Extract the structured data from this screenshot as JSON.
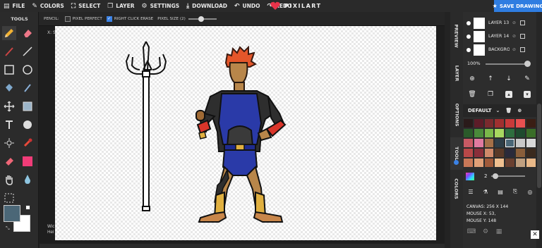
{
  "menu": [
    {
      "label": "FILE",
      "icon": "file-icon"
    },
    {
      "label": "COLORS",
      "icon": "eyedropper-icon"
    },
    {
      "label": "SELECT",
      "icon": "select-icon"
    },
    {
      "label": "LAYER",
      "icon": "layer-icon"
    },
    {
      "label": "SETTINGS",
      "icon": "gear-icon"
    },
    {
      "label": "DOWNLOAD",
      "icon": "download-icon"
    },
    {
      "label": "UNDO",
      "icon": "undo-icon"
    },
    {
      "label": "REDO",
      "icon": "redo-icon"
    }
  ],
  "brand": {
    "name": "PIXILART",
    "color": "#e8334a"
  },
  "save_button": "SAVE DRAWING",
  "options": {
    "tool_label": "PENCIL:",
    "pixel_perfect": "PIXEL PERFECT",
    "pixel_perfect_checked": false,
    "right_click_erase": "RIGHT CLICK ERASE",
    "right_click_erase_checked": true,
    "pixel_size": "PIXEL SIZE (2)"
  },
  "tools_title": "TOOLS",
  "canvas_overlay": {
    "coords_label": "X: S",
    "dims_line1": "Wic",
    "dims_line2": "Hei"
  },
  "vertical_tabs": [
    "PREVIEW",
    "LAYER",
    "OPTIONS",
    "TOOL",
    "COLORS"
  ],
  "layers": [
    {
      "name": "LAYER 13"
    },
    {
      "name": "LAYER 14"
    },
    {
      "name": "BACKGROUND"
    }
  ],
  "zoom": "100%",
  "palette": {
    "name": "DEFAULT",
    "colors": [
      "#2a1a1a",
      "#5c1c28",
      "#7a2a2e",
      "#a03030",
      "#c83a3a",
      "#e85050",
      "#3a1e14",
      "#2a5a2a",
      "#4a8a3a",
      "#7ab84a",
      "#a8d860",
      "#2e6e3e",
      "#1e4a2e",
      "#3a6e28",
      "#c85a64",
      "#e07aa0",
      "#a47048",
      "#2e3e48",
      "#4b6777",
      "#c8c8c8",
      "#d8d8d8",
      "#b84848",
      "#8a2e3a",
      "#d08a6a",
      "#5a3a28",
      "#2a2a3a",
      "#8a5e3a",
      "#3a2a1e",
      "#c87858",
      "#e0a078",
      "#a05a3a",
      "#f0c090",
      "#6a4030",
      "#c0a080",
      "#e8b888"
    ],
    "selected_index": 18
  },
  "brush_size": "2",
  "canvas_info": {
    "canvas": "CANVAS: 256 X 144",
    "mouse_x": "MOUSE X: 53,",
    "mouse_y": "MOUSE Y: 148"
  }
}
